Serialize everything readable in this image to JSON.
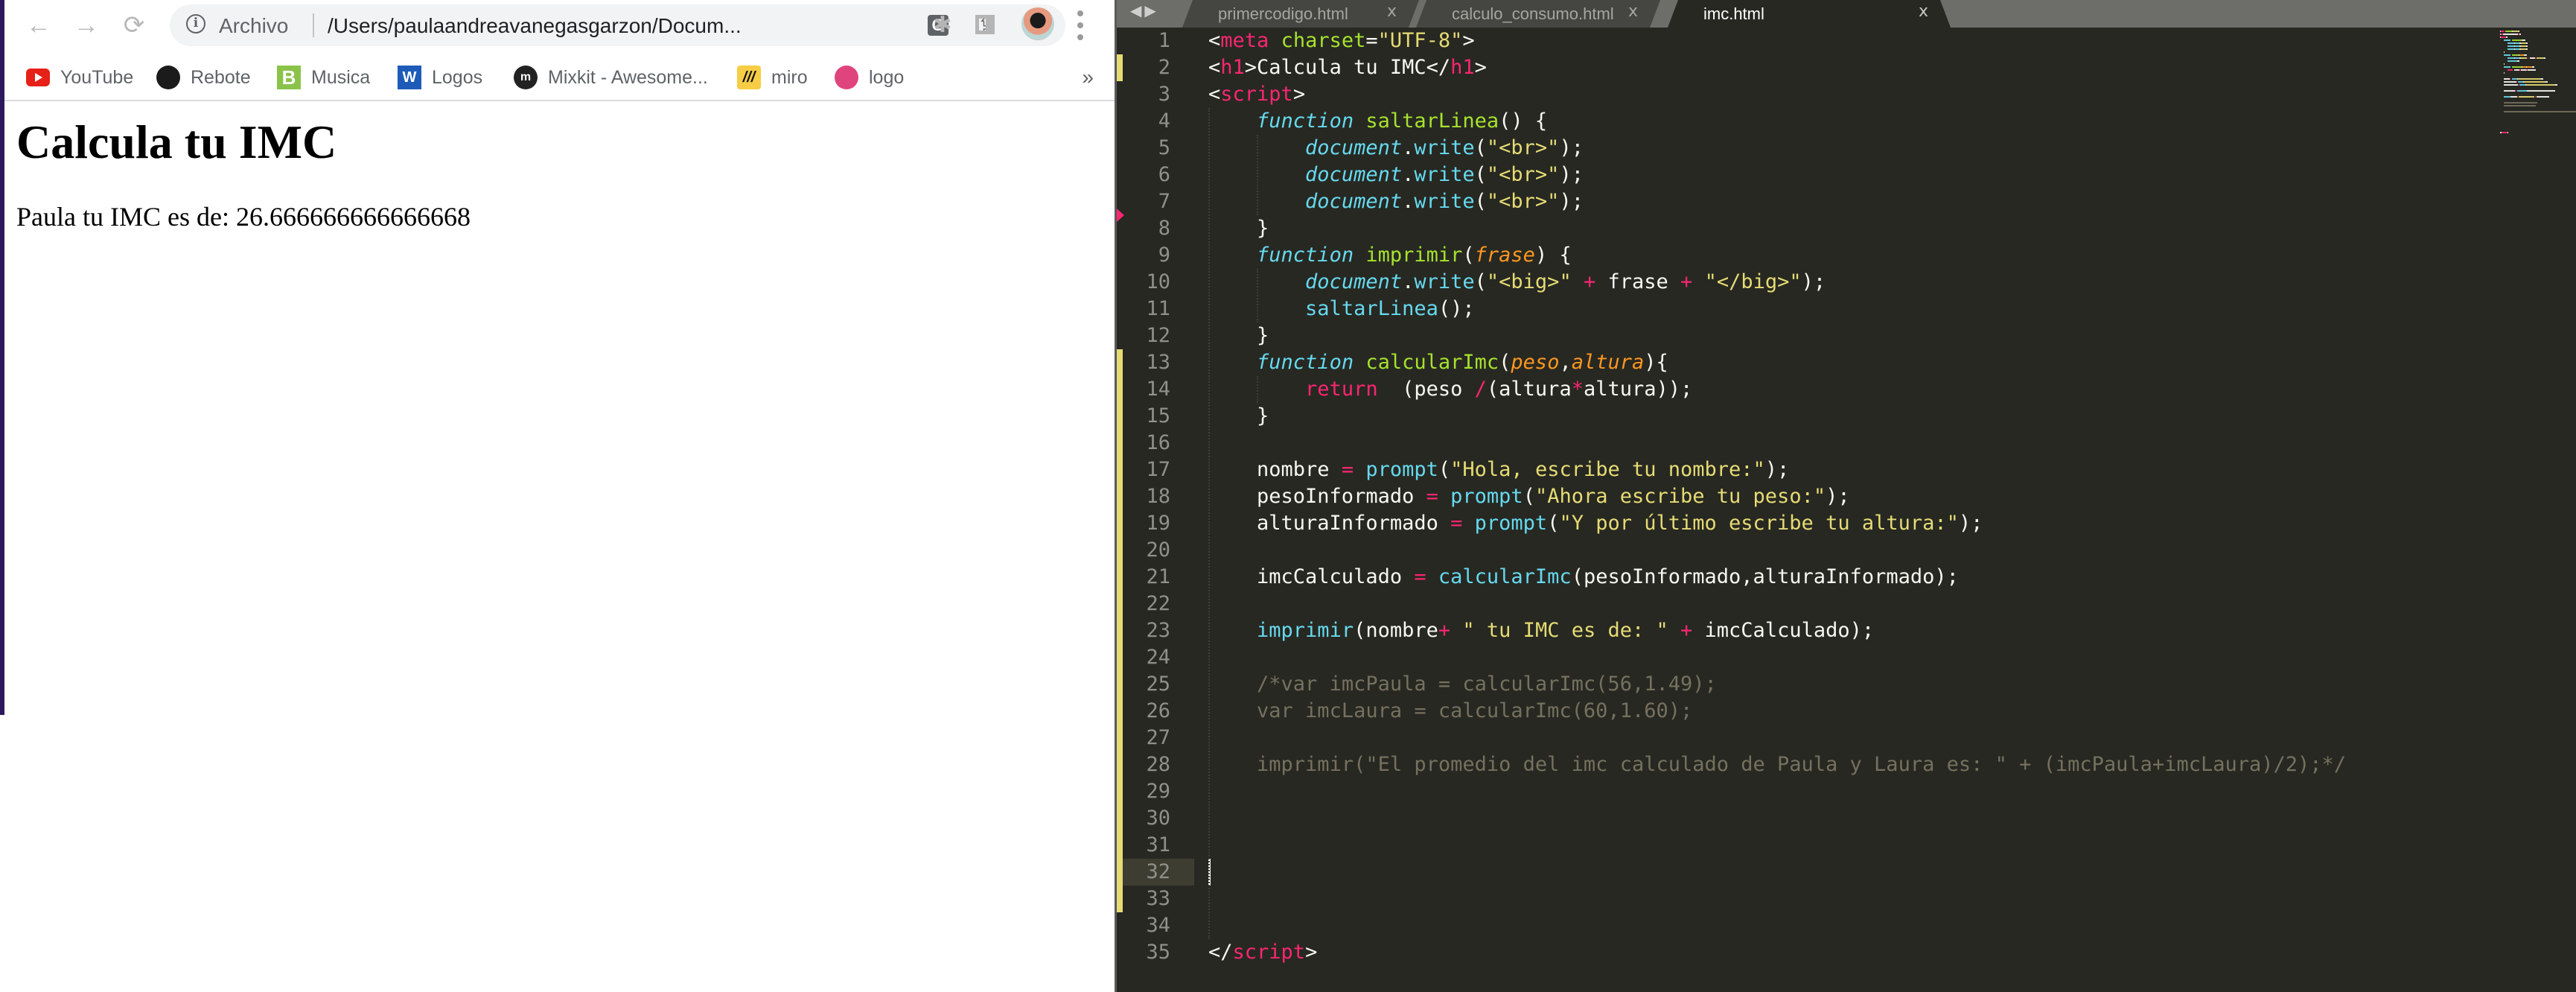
{
  "browser": {
    "nav": {
      "back_icon": "←",
      "forward_icon": "→",
      "reload_icon": "⟳"
    },
    "address_bar": {
      "scheme_label": "Archivo",
      "url": "/Users/paulaandreavanegasgarzon/Docum...",
      "icons": {
        "translate": "G̶",
        "share": "⇪",
        "bookmark": "☆"
      }
    },
    "toolbar_icons": {
      "extensions": "✱",
      "side_panel": "▯"
    },
    "bookmarks": [
      {
        "label": "YouTube",
        "icon": "youtube-icon",
        "color": "#e62117"
      },
      {
        "label": "Rebote",
        "icon": "github-icon",
        "color": "#1b1b1b"
      },
      {
        "label": "Musica",
        "icon": "b-logo-icon",
        "color": "#8bc34a"
      },
      {
        "label": "Logos",
        "icon": "w-logo-icon",
        "color": "#1e5bb8"
      },
      {
        "label": "Mixkit - Awesome...",
        "icon": "mixkit-icon",
        "color": "#222222"
      },
      {
        "label": "miro",
        "icon": "miro-icon",
        "color": "#f7cd45"
      },
      {
        "label": "logo",
        "icon": "dribbble-icon",
        "color": "#e0447c"
      }
    ],
    "bookmarks_more": "»",
    "page": {
      "heading": "Calcula tu IMC",
      "result": "Paula tu IMC es de: 26.666666666666668"
    }
  },
  "editor": {
    "tabs": [
      {
        "name": "primercodigo.html",
        "close": "x",
        "active": false
      },
      {
        "name": "calculo_consumo.html",
        "close": "x",
        "active": false
      },
      {
        "name": "imc.html",
        "close": "x",
        "active": true
      }
    ],
    "current_line": 32,
    "lines": [
      {
        "n": "1",
        "tokens": [
          [
            "tag_p",
            "<"
          ],
          [
            "tag",
            "meta"
          ],
          [
            "plain",
            " "
          ],
          [
            "attr",
            "charset"
          ],
          [
            "plain",
            "="
          ],
          [
            "str",
            "\"UTF-8\""
          ],
          [
            "plain",
            ">"
          ]
        ]
      },
      {
        "n": "2",
        "tokens": [
          [
            "plain",
            "<"
          ],
          [
            "tag",
            "h1"
          ],
          [
            "plain",
            ">Calcula tu IMC</"
          ],
          [
            "tag",
            "h1"
          ],
          [
            "plain",
            ">"
          ]
        ]
      },
      {
        "n": "3",
        "tokens": [
          [
            "plain",
            "<"
          ],
          [
            "tag",
            "script"
          ],
          [
            "plain",
            ">"
          ]
        ]
      },
      {
        "n": "4",
        "tokens": [
          [
            "plain",
            "    "
          ],
          [
            "kw",
            "function"
          ],
          [
            "plain",
            " "
          ],
          [
            "fn",
            "saltarLinea"
          ],
          [
            "plain",
            "() {"
          ]
        ]
      },
      {
        "n": "5",
        "tokens": [
          [
            "plain",
            "        "
          ],
          [
            "obj",
            "document"
          ],
          [
            "plain",
            "."
          ],
          [
            "sup",
            "write"
          ],
          [
            "plain",
            "("
          ],
          [
            "str",
            "\"<br>\""
          ],
          [
            "plain",
            ");"
          ]
        ]
      },
      {
        "n": "6",
        "tokens": [
          [
            "plain",
            "        "
          ],
          [
            "obj",
            "document"
          ],
          [
            "plain",
            "."
          ],
          [
            "sup",
            "write"
          ],
          [
            "plain",
            "("
          ],
          [
            "str",
            "\"<br>\""
          ],
          [
            "plain",
            ");"
          ]
        ]
      },
      {
        "n": "7",
        "tokens": [
          [
            "plain",
            "        "
          ],
          [
            "obj",
            "document"
          ],
          [
            "plain",
            "."
          ],
          [
            "sup",
            "write"
          ],
          [
            "plain",
            "("
          ],
          [
            "str",
            "\"<br>\""
          ],
          [
            "plain",
            ");"
          ]
        ]
      },
      {
        "n": "8",
        "tokens": [
          [
            "plain",
            "    }"
          ]
        ]
      },
      {
        "n": "9",
        "tokens": [
          [
            "plain",
            "    "
          ],
          [
            "kw",
            "function"
          ],
          [
            "plain",
            " "
          ],
          [
            "fn",
            "imprimir"
          ],
          [
            "plain",
            "("
          ],
          [
            "param",
            "frase"
          ],
          [
            "plain",
            ") {"
          ]
        ]
      },
      {
        "n": "10",
        "tokens": [
          [
            "plain",
            "        "
          ],
          [
            "obj",
            "document"
          ],
          [
            "plain",
            "."
          ],
          [
            "sup",
            "write"
          ],
          [
            "plain",
            "("
          ],
          [
            "str",
            "\"<big>\""
          ],
          [
            "plain",
            " "
          ],
          [
            "op",
            "+"
          ],
          [
            "plain",
            " frase "
          ],
          [
            "op",
            "+"
          ],
          [
            "plain",
            " "
          ],
          [
            "str",
            "\"</big>\""
          ],
          [
            "plain",
            ");"
          ]
        ]
      },
      {
        "n": "11",
        "tokens": [
          [
            "plain",
            "        "
          ],
          [
            "sup",
            "saltarLinea"
          ],
          [
            "plain",
            "();"
          ]
        ]
      },
      {
        "n": "12",
        "tokens": [
          [
            "plain",
            "    }"
          ]
        ]
      },
      {
        "n": "13",
        "tokens": [
          [
            "plain",
            "    "
          ],
          [
            "kw",
            "function"
          ],
          [
            "plain",
            " "
          ],
          [
            "fn",
            "calcularImc"
          ],
          [
            "plain",
            "("
          ],
          [
            "param",
            "peso"
          ],
          [
            "plain",
            ","
          ],
          [
            "param",
            "altura"
          ],
          [
            "plain",
            "){"
          ]
        ]
      },
      {
        "n": "14",
        "tokens": [
          [
            "plain",
            "        "
          ],
          [
            "op",
            "return"
          ],
          [
            "plain",
            "  (peso "
          ],
          [
            "op",
            "/"
          ],
          [
            "plain",
            "(altura"
          ],
          [
            "op",
            "*"
          ],
          [
            "plain",
            "altura));"
          ]
        ]
      },
      {
        "n": "15",
        "tokens": [
          [
            "plain",
            "    }"
          ]
        ]
      },
      {
        "n": "16",
        "tokens": []
      },
      {
        "n": "17",
        "tokens": [
          [
            "plain",
            "    nombre "
          ],
          [
            "op",
            "="
          ],
          [
            "plain",
            " "
          ],
          [
            "sup",
            "prompt"
          ],
          [
            "plain",
            "("
          ],
          [
            "str",
            "\"Hola, escribe tu nombre:\""
          ],
          [
            "plain",
            ");"
          ]
        ]
      },
      {
        "n": "18",
        "tokens": [
          [
            "plain",
            "    pesoInformado "
          ],
          [
            "op",
            "="
          ],
          [
            "plain",
            " "
          ],
          [
            "sup",
            "prompt"
          ],
          [
            "plain",
            "("
          ],
          [
            "str",
            "\"Ahora escribe tu peso:\""
          ],
          [
            "plain",
            ");"
          ]
        ]
      },
      {
        "n": "19",
        "tokens": [
          [
            "plain",
            "    alturaInformado "
          ],
          [
            "op",
            "="
          ],
          [
            "plain",
            " "
          ],
          [
            "sup",
            "prompt"
          ],
          [
            "plain",
            "("
          ],
          [
            "str",
            "\"Y por último escribe tu altura:\""
          ],
          [
            "plain",
            ");"
          ]
        ]
      },
      {
        "n": "20",
        "tokens": []
      },
      {
        "n": "21",
        "tokens": [
          [
            "plain",
            "    imcCalculado "
          ],
          [
            "op",
            "="
          ],
          [
            "plain",
            " "
          ],
          [
            "sup",
            "calcularImc"
          ],
          [
            "plain",
            "(pesoInformado,alturaInformado);"
          ]
        ]
      },
      {
        "n": "22",
        "tokens": []
      },
      {
        "n": "23",
        "tokens": [
          [
            "plain",
            "    "
          ],
          [
            "sup",
            "imprimir"
          ],
          [
            "plain",
            "(nombre"
          ],
          [
            "op",
            "+"
          ],
          [
            "plain",
            " "
          ],
          [
            "str",
            "\" tu IMC es de: \""
          ],
          [
            "plain",
            " "
          ],
          [
            "op",
            "+"
          ],
          [
            "plain",
            " imcCalculado);"
          ]
        ]
      },
      {
        "n": "24",
        "tokens": []
      },
      {
        "n": "25",
        "tokens": [
          [
            "plain",
            "    "
          ],
          [
            "cm",
            "/*var imcPaula = calcularImc(56,1.49);"
          ]
        ]
      },
      {
        "n": "26",
        "tokens": [
          [
            "plain",
            "    "
          ],
          [
            "cm",
            "var imcLaura = calcularImc(60,1.60);"
          ]
        ]
      },
      {
        "n": "27",
        "tokens": []
      },
      {
        "n": "28",
        "tokens": [
          [
            "plain",
            "    "
          ],
          [
            "cm",
            "imprimir(\"El promedio del imc calculado de Paula y Laura es: \" + (imcPaula+imcLaura)/2);*/"
          ]
        ]
      },
      {
        "n": "29",
        "tokens": []
      },
      {
        "n": "30",
        "tokens": []
      },
      {
        "n": "31",
        "tokens": []
      },
      {
        "n": "32",
        "tokens": []
      },
      {
        "n": "33",
        "tokens": []
      },
      {
        "n": "34",
        "tokens": []
      },
      {
        "n": "35",
        "tokens": [
          [
            "plain",
            "</"
          ],
          [
            "tag",
            "script"
          ],
          [
            "plain",
            ">"
          ]
        ]
      }
    ],
    "modified_lines": [
      2,
      13,
      14,
      15,
      16,
      17,
      18,
      19,
      20,
      21,
      22,
      23,
      24,
      25,
      26,
      27,
      28,
      29,
      30,
      31,
      32,
      33
    ],
    "deleted_marker_after_line": 7
  }
}
